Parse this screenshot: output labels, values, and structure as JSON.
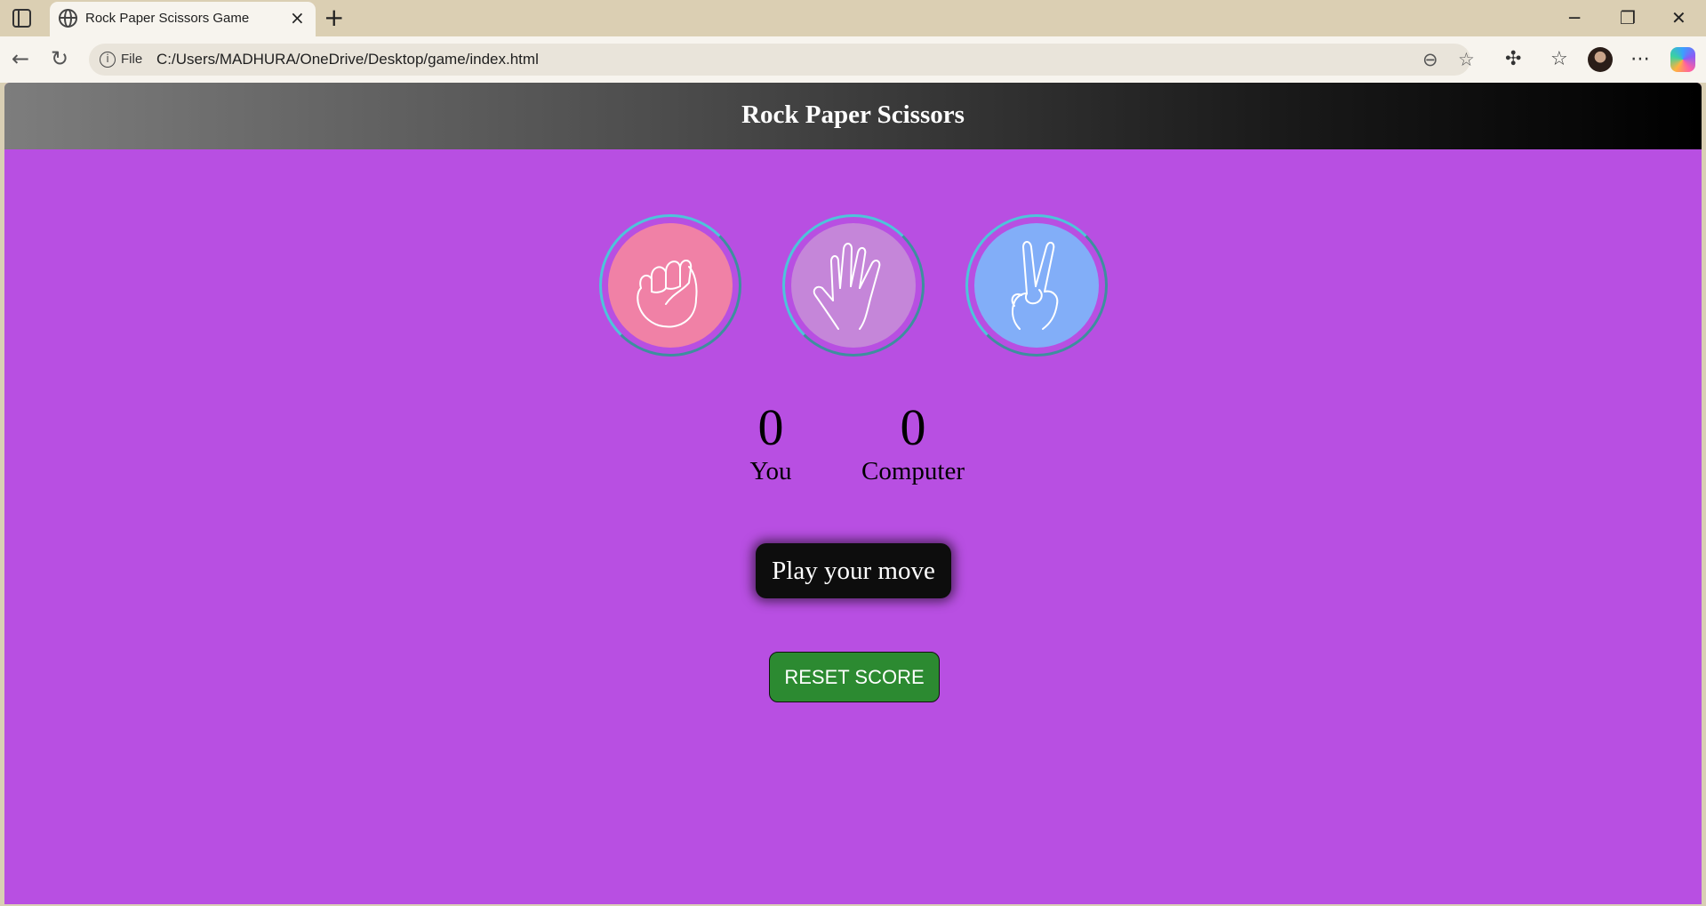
{
  "browser": {
    "tab_title": "Rock Paper Scissors Game",
    "tab_close": "×",
    "new_tab": "+",
    "file_label": "File",
    "url": "C:/Users/MADHURA/OneDrive/Desktop/game/index.html",
    "window_controls": {
      "minimize": "─",
      "restore": "❐",
      "close": "✕"
    },
    "nav": {
      "back": "←",
      "reload": "↻"
    },
    "toolbar_icons": {
      "zoom": "⊖",
      "favorite": "☆",
      "extensions": "✣",
      "favorites": "☆",
      "more": "⋯"
    }
  },
  "page": {
    "title": "Rock Paper Scissors",
    "choices": [
      {
        "name": "rock",
        "color": "#f081a6"
      },
      {
        "name": "paper",
        "color": "#c586d9"
      },
      {
        "name": "scissors",
        "color": "#82aef8"
      }
    ],
    "scores": {
      "user_score": "0",
      "user_label": "You",
      "computer_score": "0",
      "computer_label": "Computer"
    },
    "message": "Play your move",
    "reset_label": "RESET SCORE"
  },
  "colors": {
    "page_background": "#b84fe2",
    "reset_button": "#2c8a31",
    "message_background": "#0d0d0d"
  }
}
